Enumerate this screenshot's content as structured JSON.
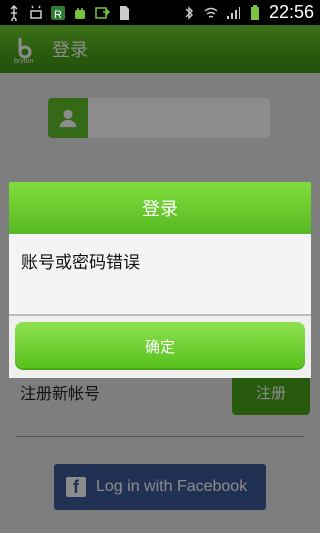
{
  "status_bar": {
    "time": "22:56",
    "icons": [
      "usb-icon",
      "android-debug-icon",
      "r-app-icon",
      "android-icon",
      "export-icon",
      "sd-card-icon",
      "bluetooth-icon",
      "wifi-icon",
      "signal-icon",
      "battery-icon"
    ]
  },
  "header": {
    "logo_text": "bryton",
    "title": "登录"
  },
  "form": {
    "register_prompt": "注册新帐号",
    "register_button": "注册",
    "facebook_button": "Log in with Facebook"
  },
  "dialog": {
    "title": "登录",
    "message": "账号或密码错误",
    "ok_button": "确定"
  },
  "colors": {
    "green_primary": "#58b922",
    "facebook_blue": "#3b5998"
  }
}
